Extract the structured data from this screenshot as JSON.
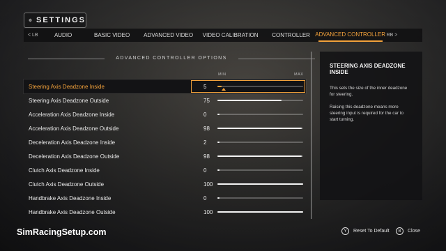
{
  "header": {
    "title": "SETTINGS"
  },
  "tabs": {
    "left_hint": "< LB",
    "right_hint": "RB >",
    "items": [
      {
        "label": "AUDIO"
      },
      {
        "label": "BASIC VIDEO"
      },
      {
        "label": "ADVANCED VIDEO"
      },
      {
        "label": "VIDEO CALIBRATION"
      },
      {
        "label": "CONTROLLER"
      },
      {
        "label": "ADVANCED CONTROLLER"
      }
    ],
    "active": "ADVANCED CONTROLLER"
  },
  "section": {
    "title": "ADVANCED CONTROLLER OPTIONS",
    "min_label": "MIN",
    "max_label": "MAX"
  },
  "rows": [
    {
      "label": "Steering Axis Deadzone Inside",
      "value": "5",
      "fraction": 0.05
    },
    {
      "label": "Steering Axis Deadzone Outside",
      "value": "75",
      "fraction": 0.75
    },
    {
      "label": "Acceleration Axis Deadzone Inside",
      "value": "0",
      "fraction": 0.0
    },
    {
      "label": "Acceleration Axis Deadzone Outside",
      "value": "98",
      "fraction": 0.98
    },
    {
      "label": "Deceleration Axis Deadzone Inside",
      "value": "2",
      "fraction": 0.02
    },
    {
      "label": "Deceleration Axis Deadzone Outside",
      "value": "98",
      "fraction": 0.98
    },
    {
      "label": "Clutch Axis Deadzone Inside",
      "value": "0",
      "fraction": 0.0
    },
    {
      "label": "Clutch Axis Deadzone Outside",
      "value": "100",
      "fraction": 1.0
    },
    {
      "label": "Handbrake Axis Deadzone Inside",
      "value": "0",
      "fraction": 0.0
    },
    {
      "label": "Handbrake Axis Deadzone Outside",
      "value": "100",
      "fraction": 1.0
    }
  ],
  "selected_row": 0,
  "info": {
    "title": "STEERING AXIS DEADZONE INSIDE",
    "paragraphs": [
      "This sets the size of the inner deadzone for steering.",
      "Raising this deadzone means more steering input is required for the car to start turning."
    ]
  },
  "footer": {
    "brand": "SimRacingSetup.com",
    "actions": [
      {
        "glyph": "Y",
        "label": "Reset To Default"
      },
      {
        "glyph": "B",
        "label": "Close"
      }
    ]
  },
  "colors": {
    "accent": "#f3a23b"
  }
}
